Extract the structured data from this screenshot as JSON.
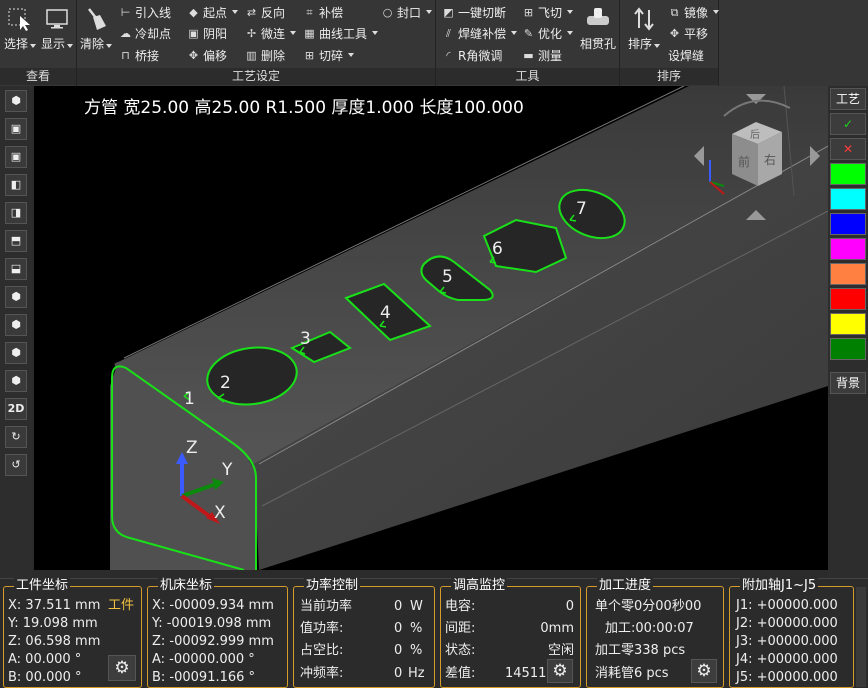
{
  "ribbon": {
    "view_group": {
      "title": "查看",
      "select": "选择",
      "display": "显示"
    },
    "craft_group": {
      "title": "工艺设定",
      "clear": "清除",
      "items": [
        "引入线",
        "冷却点",
        "桥接",
        "起点",
        "阴阳",
        "偏移",
        "反向",
        "微连",
        "删除",
        "补偿",
        "曲线工具",
        "切碎",
        "封口"
      ]
    },
    "tool_group": {
      "title": "工具",
      "items": [
        "一键切断",
        "焊缝补偿",
        "R角微调",
        "飞切",
        "优化",
        "测量"
      ],
      "big": "相贯孔"
    },
    "sort_group": {
      "title": "排序",
      "sort": "排序",
      "items": [
        "镜像",
        "平移",
        "设焊缝"
      ]
    }
  },
  "left_toolbar": [
    "cube-iso",
    "cube-front",
    "cube-back",
    "cube-left",
    "cube-right",
    "cube-top",
    "cube-bottom",
    "cube-iso-1",
    "cube-iso-2",
    "cube-iso-3",
    "cube-iso-4",
    "2D",
    "rotate-cw",
    "rotate-ccw"
  ],
  "left_2d_label": "2D",
  "viewport": {
    "info": "方管 宽25.00 高25.00 R1.500 厚度1.000 长度100.000",
    "part_labels": [
      "1",
      "2",
      "3",
      "4",
      "5",
      "6",
      "7"
    ],
    "axis": {
      "z": "Z",
      "y": "Y",
      "x": "X"
    },
    "cube_faces": {
      "top": "后",
      "front": "前",
      "right": "右"
    }
  },
  "right_toolbar": {
    "craft": "工艺",
    "ok": "✓",
    "cancel": "✕",
    "background": "背景",
    "swatches": [
      "#00ff00",
      "#00ffff",
      "#0000ff",
      "#ff00ff",
      "#ff8040",
      "#ff0000",
      "#ffff00",
      "#008000"
    ]
  },
  "panels": {
    "work_coord": {
      "title": "工件坐标",
      "x": "X: 37.511 mm",
      "y": "Y: 19.098 mm",
      "z": "Z: 06.598 mm",
      "a": "A: 00.000 °",
      "b": "B: 00.000 °",
      "btn": "工件"
    },
    "machine_coord": {
      "title": "机床坐标",
      "x": "X: -00009.934 mm",
      "y": "Y: -00019.098 mm",
      "z": "Z: -00092.999 mm",
      "a": "A: -00000.000 °",
      "b": "B: -00091.166 °"
    },
    "power": {
      "title": "功率控制",
      "r1l": "当前功率",
      "r1v": "0",
      "r1u": "W",
      "r2l": "值功率:",
      "r2v": "0",
      "r2u": "%",
      "r3l": "占空比:",
      "r3v": "0",
      "r3u": "%",
      "r4l": "冲频率:",
      "r4v": "0",
      "r4u": "Hz"
    },
    "height": {
      "title": "调高监控",
      "r1l": "电容:",
      "r1v": "0",
      "r2l": "间距:",
      "r2v": "0mm",
      "r3l": "状态:",
      "r3v": "空闲",
      "r4l": "差值:",
      "r4v": "145116"
    },
    "progress": {
      "title": "加工进度",
      "r1": "单个零0分00秒00",
      "r2": "加工:00:00:07",
      "r3": "加工零338 pcs",
      "r4": "消耗管6 pcs"
    },
    "aux": {
      "title": "附加轴J1~J5",
      "j1": "J1: +00000.000",
      "j2": "J2: +00000.000",
      "j3": "J3: +00000.000",
      "j4": "J4: +00000.000",
      "j5": "J5: +00000.000"
    }
  }
}
